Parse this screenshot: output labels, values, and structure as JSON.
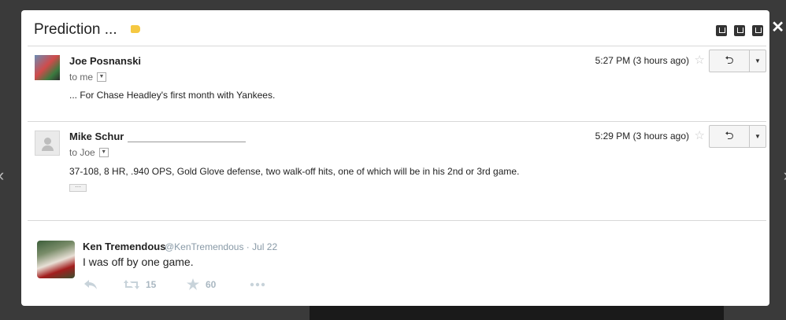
{
  "thread": {
    "title": "Prediction ...",
    "tag_color": "#f5c842"
  },
  "messages": [
    {
      "sender": "Joe Posnanski",
      "to": "to me",
      "time": "5:27 PM (3 hours ago)",
      "body": "... For Chase Headley's first month with Yankees."
    },
    {
      "sender": "Mike Schur",
      "to": "to Joe",
      "time": "5:29 PM (3 hours ago)",
      "body": "37-108, 8 HR, .940 OPS, Gold Glove defense, two walk-off hits, one of which will be in his 2nd or 3rd game.",
      "ellipsis": "···"
    }
  ],
  "tweet": {
    "name": "Ken Tremendous",
    "handle_date": "@KenTremendous · Jul 22",
    "text": "I was off by one game.",
    "retweets": "15",
    "favorites": "60"
  },
  "icons": {
    "reply": "↰",
    "star": "☆",
    "close": "✕",
    "prev": "‹",
    "next": "›"
  }
}
